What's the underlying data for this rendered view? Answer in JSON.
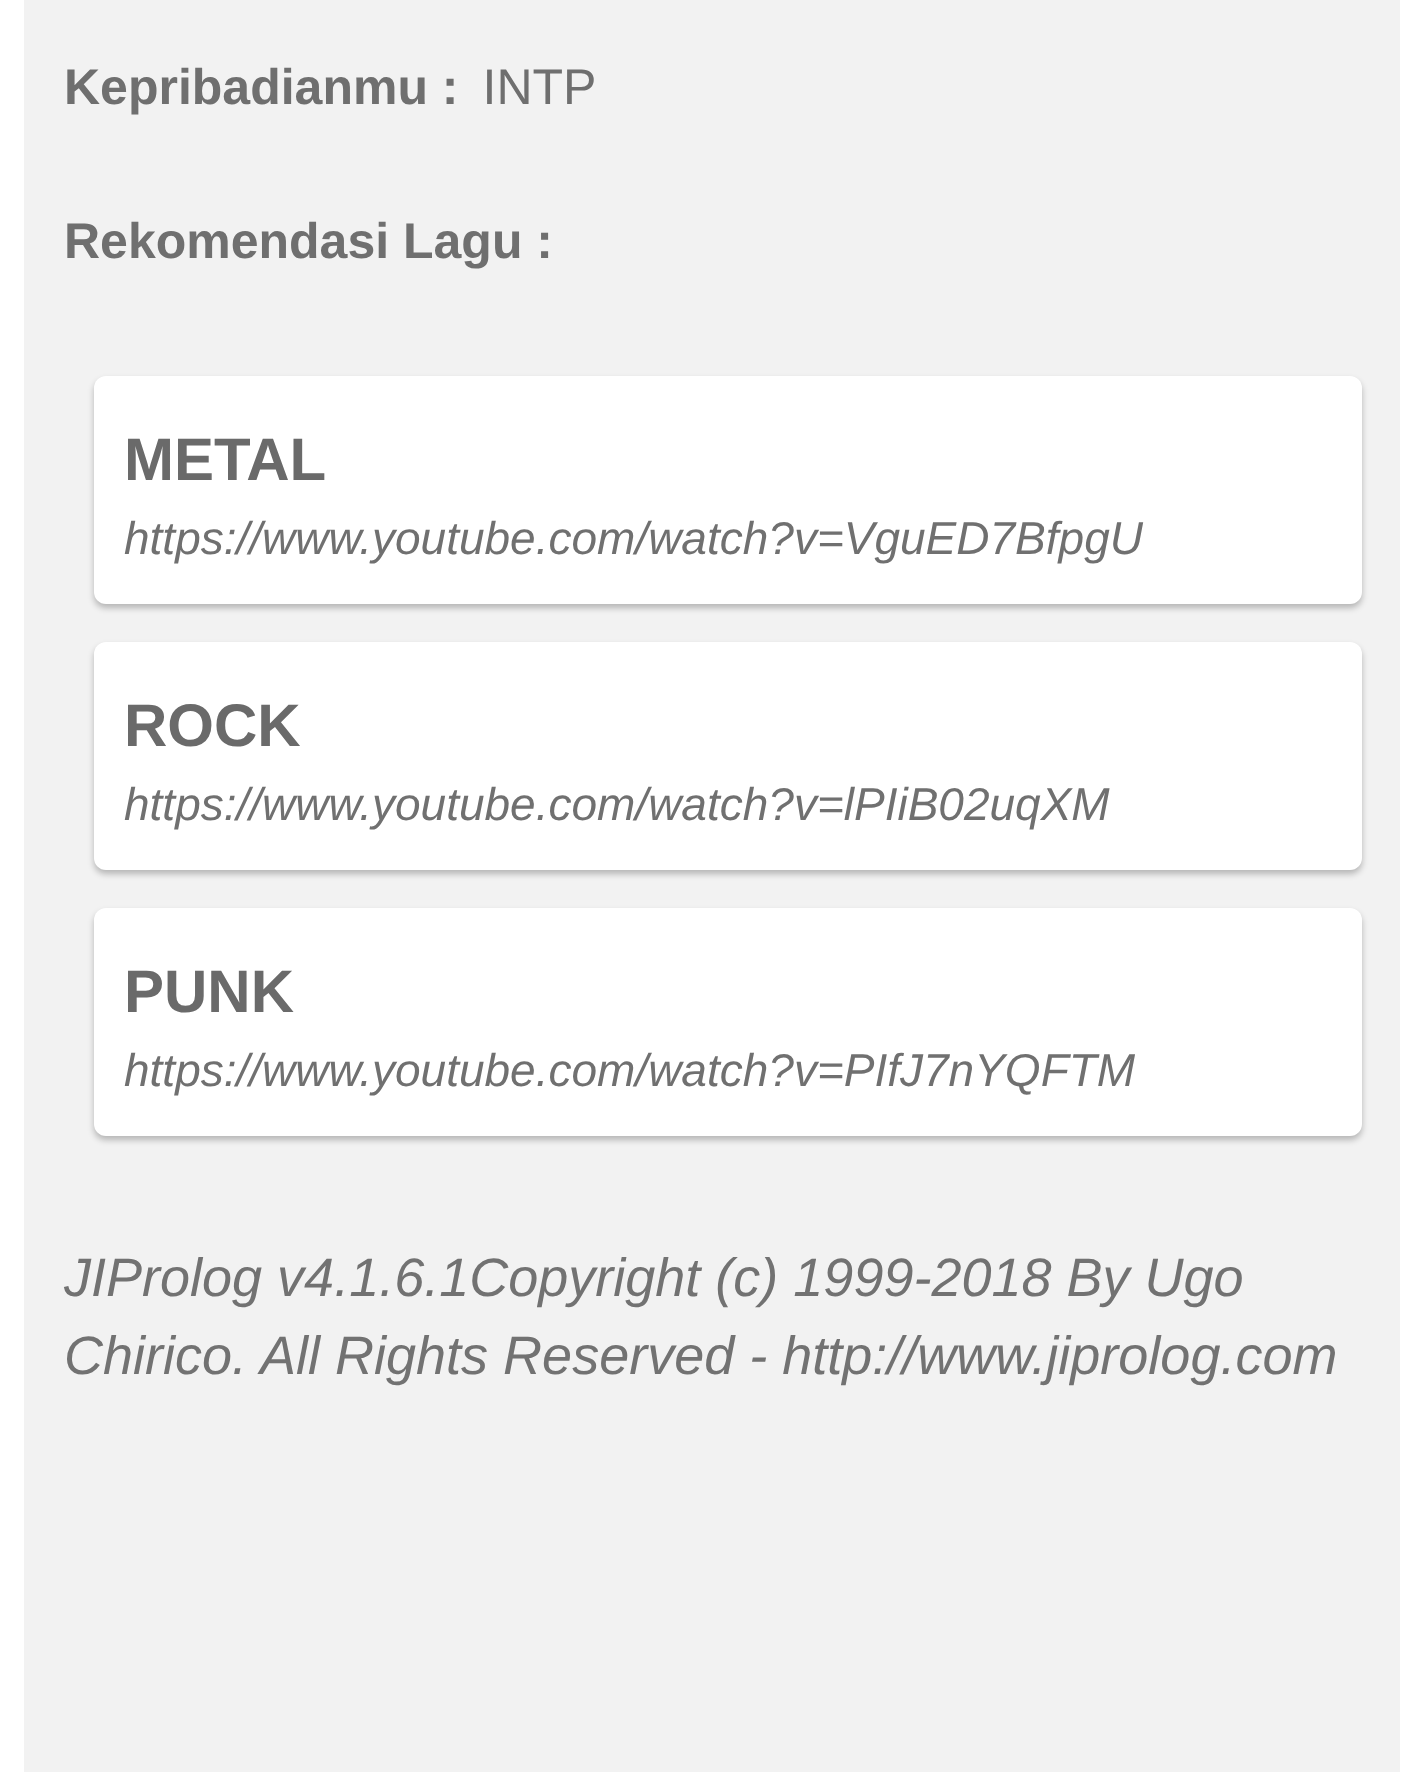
{
  "personality": {
    "label": "Kepribadianmu :",
    "value": "INTP"
  },
  "recommendation_heading": "Rekomendasi Lagu :",
  "songs": [
    {
      "genre": "METAL",
      "url": "https://www.youtube.com/watch?v=VguED7BfpgU"
    },
    {
      "genre": "ROCK",
      "url": "https://www.youtube.com/watch?v=lPIiB02uqXM"
    },
    {
      "genre": "PUNK",
      "url": "https://www.youtube.com/watch?v=PIfJ7nYQFTM"
    }
  ],
  "footer": "JIProlog v4.1.6.1Copyright (c) 1999-2018 By Ugo Chirico. All Rights Reserved - http://www.jiprolog.com"
}
